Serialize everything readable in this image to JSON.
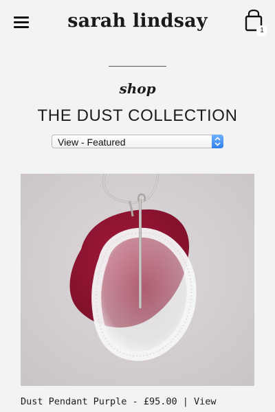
{
  "header": {
    "brand": "sarah lindsay",
    "cart_count": "1",
    "menu_icon": "hamburger-icon",
    "cart_icon": "shopping-bag-icon"
  },
  "page": {
    "kicker": "shop",
    "title": "THE DUST COLLECTION"
  },
  "sort": {
    "selected": "View - Featured"
  },
  "products": [
    {
      "name": "Dust Pendant Purple",
      "price": "£95.00",
      "separator": "|",
      "link_label": "View"
    }
  ],
  "colors": {
    "background": "#f3f3f3",
    "text": "#1c1c1c",
    "select_arrow": "#2f7fe8",
    "pendant_red": "#8c1630"
  }
}
